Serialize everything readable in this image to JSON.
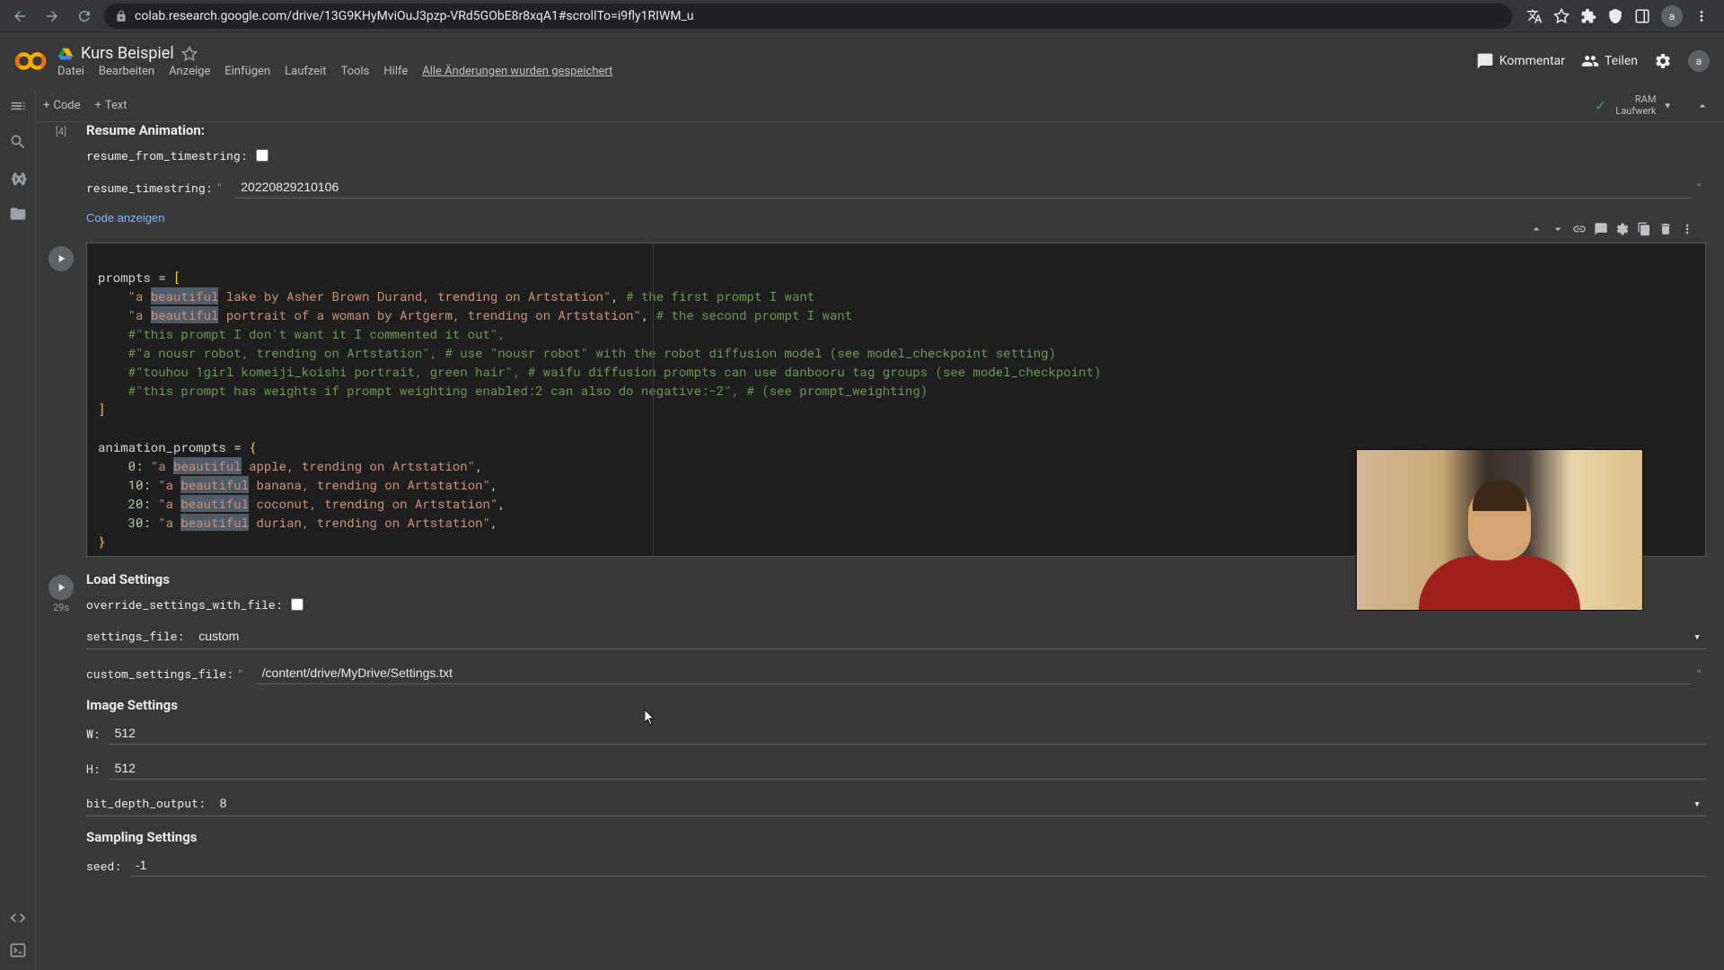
{
  "browser": {
    "url": "colab.research.google.com/drive/13G9KHyMviOuJ3pzp-VRd5GObE8r8xqA1#scrollTo=i9fly1RIWM_u"
  },
  "doc": {
    "title": "Kurs Beispiel",
    "menu": [
      "Datei",
      "Bearbeiten",
      "Anzeige",
      "Einfügen",
      "Laufzeit",
      "Tools",
      "Hilfe"
    ],
    "save_status": "Alle Änderungen wurden gespeichert"
  },
  "header": {
    "comment": "Kommentar",
    "share": "Teilen",
    "avatar": "a"
  },
  "toolbar": {
    "code": "Code",
    "text": "Text",
    "ram": "RAM",
    "disk": "Laufwerk"
  },
  "cell1": {
    "exec": "[4]",
    "title": "Resume Animation:",
    "resume_from_label": "resume_from_timestring:",
    "resume_timestring_label": "resume_timestring:",
    "resume_timestring_value": "20220829210106",
    "show_code": "Code anzeigen"
  },
  "code": {
    "line1_a": "prompts ",
    "line1_b": "=",
    "line1_c": " [",
    "line2_a": "    ",
    "line2_b": "\"a ",
    "line2_c": "beautiful",
    "line2_d": " lake by Asher Brown Durand, trending on Artstation\"",
    "line2_e": ", ",
    "line2_f": "# the first prompt I want",
    "line3_a": "    ",
    "line3_b": "\"a ",
    "line3_c": "beautiful",
    "line3_d": " portrait of a woman by Artgerm, trending on Artstation\"",
    "line3_e": ", ",
    "line3_f": "# the second prompt I want",
    "line4": "    #\"this prompt I don't want it I commented it out\",",
    "line5": "    #\"a nousr robot, trending on Artstation\", # use \"nousr robot\" with the robot diffusion model (see model_checkpoint setting)",
    "line6": "    #\"touhou 1girl komeiji_koishi portrait, green hair\", # waifu diffusion prompts can use danbooru tag groups (see model_checkpoint)",
    "line7": "    #\"this prompt has weights if prompt weighting enabled:2 can also do negative:-2\", # (see prompt_weighting)",
    "line8": "]",
    "line9": "",
    "line10_a": "animation_prompts ",
    "line10_b": "=",
    "line10_c": " {",
    "line11_a": "    ",
    "line11_b": "0",
    "line11_c": ": ",
    "line11_d": "\"a ",
    "line11_e": "beautiful",
    "line11_f": " apple, trending on Artstation\"",
    "line11_g": ",",
    "line12_a": "    ",
    "line12_b": "10",
    "line12_c": ": ",
    "line12_d": "\"a ",
    "line12_e": "beautiful",
    "line12_f": " banana, trending on Artstation\"",
    "line12_g": ",",
    "line13_a": "    ",
    "line13_b": "20",
    "line13_c": ": ",
    "line13_d": "\"a ",
    "line13_e": "beautiful",
    "line13_f": " coconut, trending on Artstation\"",
    "line13_g": ",",
    "line14_a": "    ",
    "line14_b": "30",
    "line14_c": ": ",
    "line14_d": "\"a ",
    "line14_e": "beautiful",
    "line14_f": " durian, trending on Artstation\"",
    "line14_g": ",",
    "line15": "}"
  },
  "cell3": {
    "exec": "29s",
    "title": "Load Settings",
    "override_label": "override_settings_with_file:",
    "settings_file_label": "settings_file:",
    "settings_file_value": "custom",
    "custom_settings_label": "custom_settings_file:",
    "custom_settings_value": "/content/drive/MyDrive/Settings.txt",
    "image_settings": "Image Settings",
    "w_label": "W:",
    "w_value": "512",
    "h_label": "H:",
    "h_value": "512",
    "bit_depth_label": "bit_depth_output:",
    "bit_depth_value": "8",
    "sampling_settings": "Sampling Settings",
    "seed_label": "seed:",
    "seed_value": "-1"
  }
}
